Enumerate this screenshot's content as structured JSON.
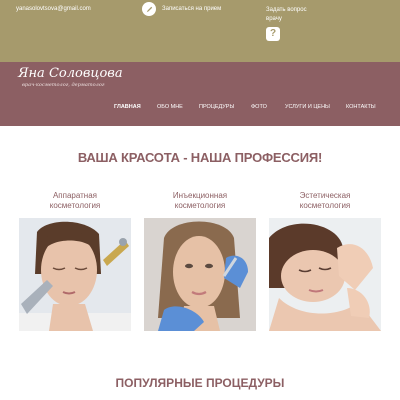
{
  "topbar": {
    "email": "yanasolovtsova@gmail.com",
    "signup_label": "Записаться на прием",
    "ask_label": "Задать вопрос",
    "ask_sub": "врачу",
    "question_mark": "?"
  },
  "brand": {
    "name": "Яна Соловцова",
    "subtitle": "врач-косметолог, дерматолог"
  },
  "menu": [
    "ГЛАВНАЯ",
    "ОБО МНЕ",
    "ПРОЦЕДУРЫ",
    "ФОТО",
    "УСЛУГИ И ЦЕНЫ",
    "КОНТАКТЫ"
  ],
  "hero_title": "ВАША КРАСОТА - НАША ПРОФЕССИЯ!",
  "cards": [
    {
      "title_line1": "Аппаратная",
      "title_line2": "косметология"
    },
    {
      "title_line1": "Инъекционная",
      "title_line2": "косметология"
    },
    {
      "title_line1": "Эстетическая",
      "title_line2": "косметология"
    }
  ],
  "section_title": "ПОПУЛЯРНЫЕ ПРОЦЕДУРЫ",
  "colors": {
    "topbar": "#a69a6c",
    "nav": "#8c5f63",
    "accent": "#8c5f63"
  }
}
